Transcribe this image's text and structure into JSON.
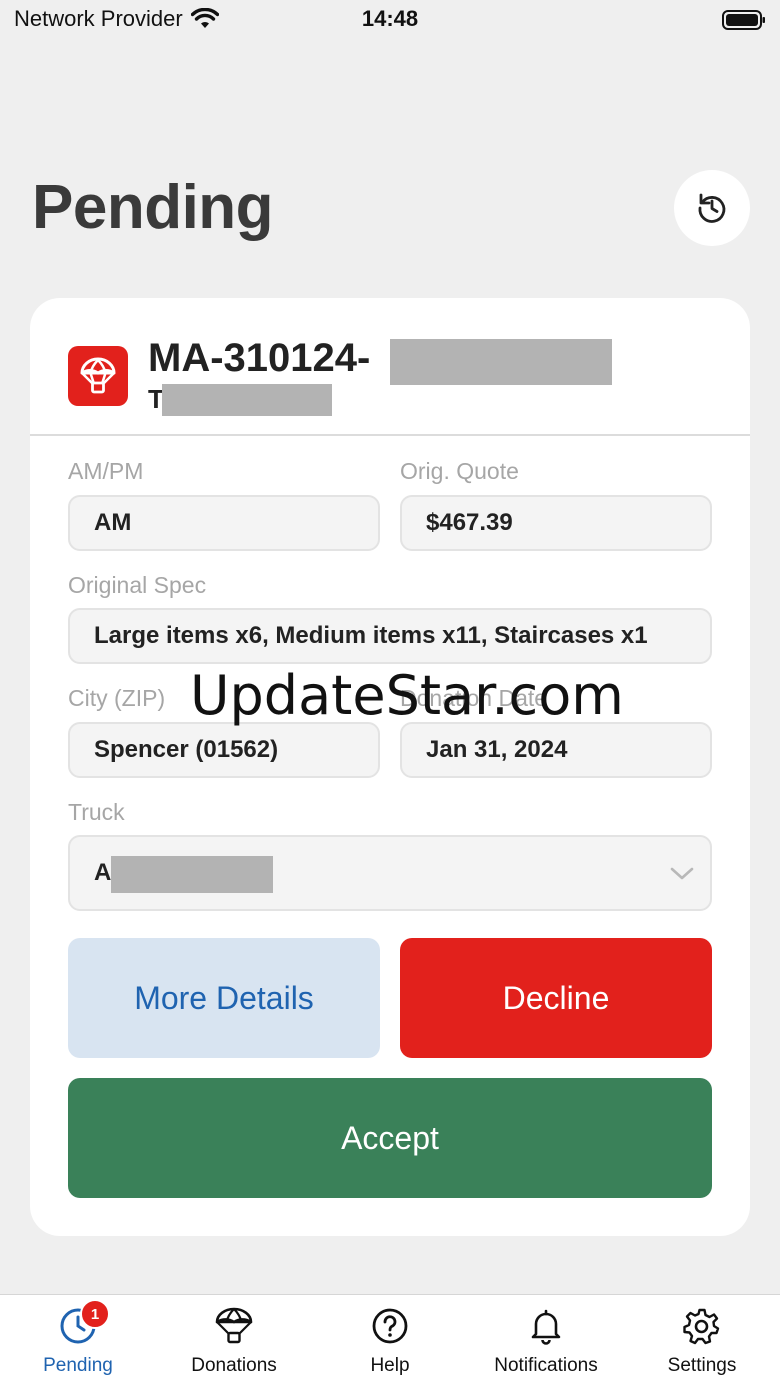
{
  "status_bar": {
    "provider": "Network Provider",
    "time": "14:48"
  },
  "header": {
    "title": "Pending"
  },
  "card": {
    "id": "MA-310124-",
    "subtitle": "T",
    "fields": {
      "ampm_label": "AM/PM",
      "ampm_value": "AM",
      "quote_label": "Orig. Quote",
      "quote_value": "$467.39",
      "spec_label": "Original Spec",
      "spec_value": "Large items x6, Medium items x11, Staircases x1",
      "city_label": "City (ZIP)",
      "city_value": "Spencer (01562)",
      "date_label": "Donation Date",
      "date_value": "Jan 31, 2024",
      "truck_label": "Truck",
      "truck_value": "A"
    },
    "buttons": {
      "details": "More Details",
      "decline": "Decline",
      "accept": "Accept"
    }
  },
  "watermark": "UpdateStar.com",
  "tabs": [
    {
      "label": "Pending",
      "badge": "1"
    },
    {
      "label": "Donations"
    },
    {
      "label": "Help"
    },
    {
      "label": "Notifications"
    },
    {
      "label": "Settings"
    }
  ],
  "colors": {
    "brand_red": "#e2211c",
    "accept_green": "#3a8159",
    "active_blue": "#1f63b0"
  },
  "icons": [
    "wifi-icon",
    "battery-icon",
    "refresh-icon",
    "parachute-icon",
    "chevron-down-icon",
    "clock-icon",
    "question-icon",
    "bell-icon",
    "gear-icon"
  ]
}
